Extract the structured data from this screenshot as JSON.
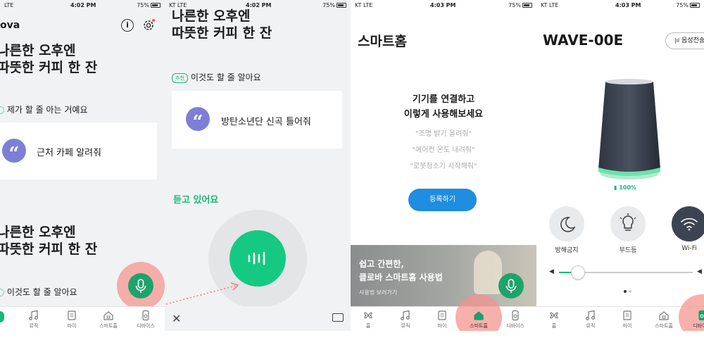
{
  "screen1": {
    "status": {
      "carrier": "LTE",
      "time": "4:02 PM",
      "battery": "75%"
    },
    "app_name": "ova",
    "headline_line1": "나른한 오후엔",
    "headline_line2": "따뜻한 커피 한 잔",
    "section_label": "제가 할 줄 아는 거예요",
    "card_text": "근처 카페 알려줘",
    "bottom_headline_line1": "나른한 오후엔",
    "bottom_headline_line2": "따뜻한 커피 한 잔",
    "bottom_section_label": "이것도 할 줄 알아요"
  },
  "screen2": {
    "status": {
      "carrier": "KT LTE",
      "time": "4:02 PM",
      "battery": "75%"
    },
    "headline_line1": "나른한 오후엔",
    "headline_line2": "따뜻한 커피 한 잔",
    "badge": "추천",
    "section_label": "이것도 할 줄 알아요",
    "card_text": "방탄소년단 신곡 틀어줘",
    "listening": "듣고 있어요"
  },
  "screen3": {
    "status": {
      "carrier": "KT LTE",
      "time": "4:03 PM",
      "battery": "75%"
    },
    "title": "스마트홈",
    "intro_line1": "기기를 연결하고",
    "intro_line2": "이렇게 사용해보세요",
    "examples": [
      "\"조명 밝기 올려줘\"",
      "\"에어컨 온도 내려줘\"",
      "\"로봇청소기 시작해줘\""
    ],
    "register_button": "등록하기",
    "banner_line1": "쉽고 간편한,",
    "banner_line2": "클로바 스마트홈 사용법",
    "banner_link": "사용법 보러가기"
  },
  "screen4": {
    "status": {
      "carrier": "KT LTE",
      "time": "4:03 PM",
      "battery": "75%"
    },
    "device_name": "WAVE-00E",
    "voice_button": "음성전송",
    "battery_level": "100%",
    "controls": [
      {
        "label": "방해금지",
        "icon": "moon-icon"
      },
      {
        "label": "무드등",
        "icon": "bulb-icon"
      },
      {
        "label": "Wi-Fi",
        "icon": "wifi-icon"
      }
    ],
    "volume_fraction": 0.14
  },
  "nav": {
    "items": [
      "홈",
      "뮤직",
      "마이",
      "스마트홈",
      "디바이스"
    ]
  },
  "colors": {
    "accent": "#16b879",
    "quote": "#7d7fd6",
    "highlight": "#f5918c"
  }
}
